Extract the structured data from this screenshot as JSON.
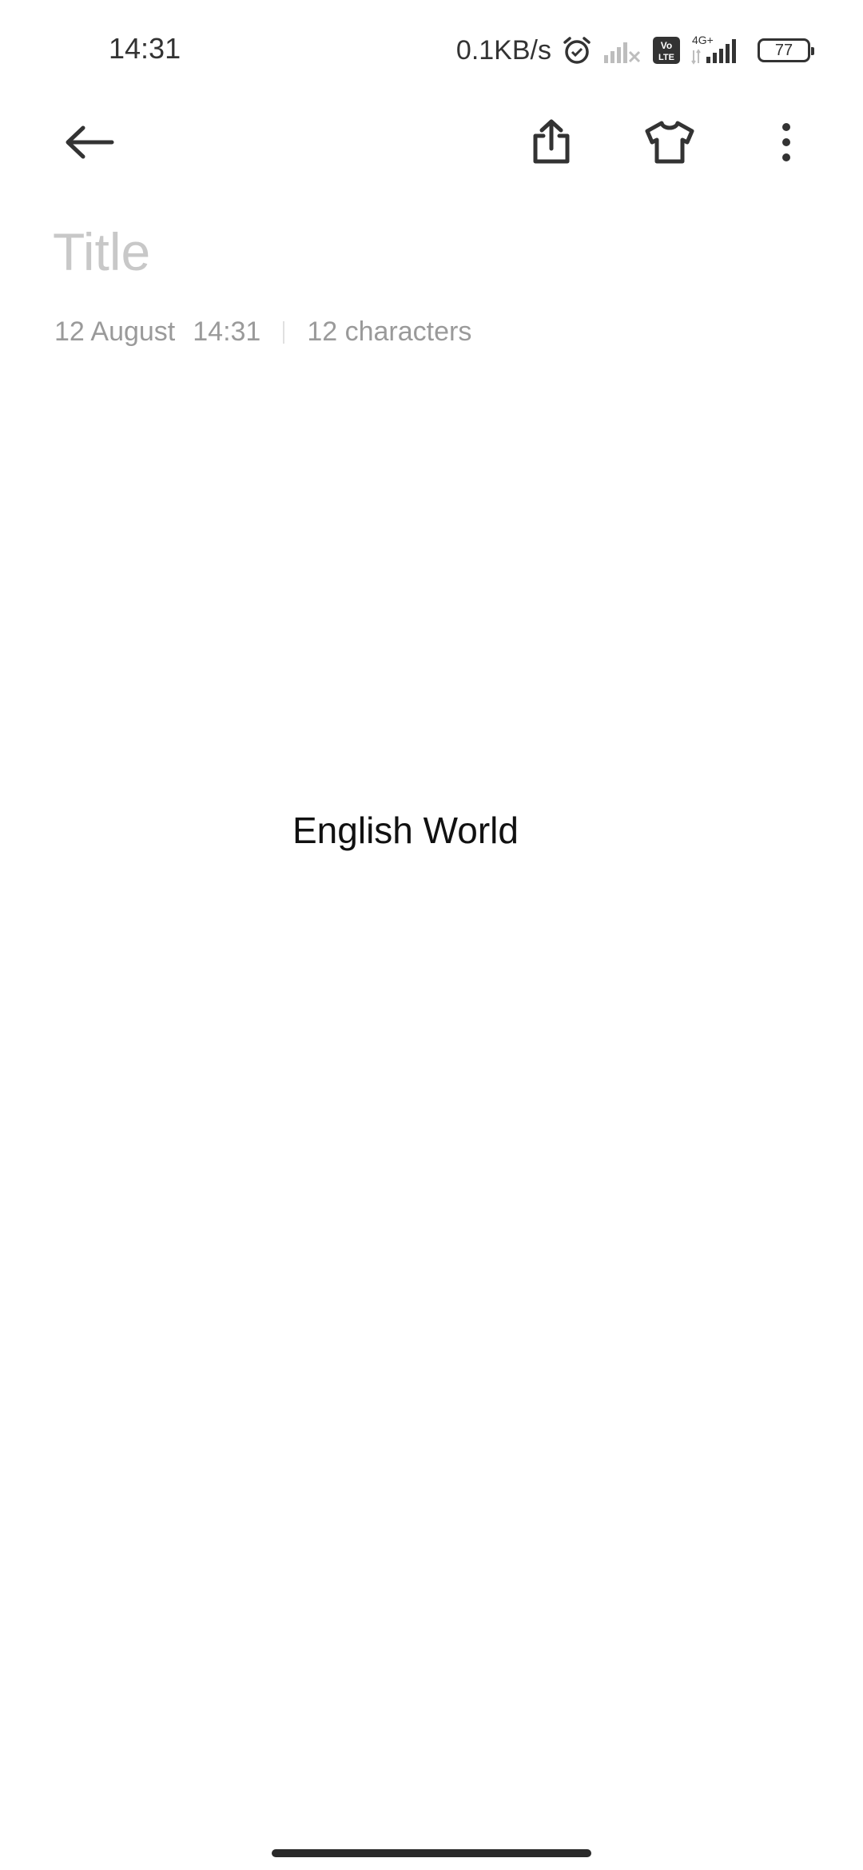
{
  "status_bar": {
    "time": "14:31",
    "net_speed": "0.1KB/s",
    "volte_label": "Vo LTE",
    "network_type": "4G+",
    "battery_level": "77",
    "icons": [
      "alarm-icon",
      "signal-off-icon",
      "volte-icon",
      "signal-icon",
      "battery-icon"
    ]
  },
  "toolbar": {
    "icons": [
      "back-arrow-icon",
      "share-icon",
      "theme-shirt-icon",
      "more-vertical-icon"
    ]
  },
  "note": {
    "title_placeholder": "Title",
    "title_value": "",
    "date": "12 August",
    "time": "14:31",
    "char_count": "12 characters",
    "body": "English World"
  },
  "colors": {
    "background": "#ffffff",
    "placeholder": "#c8c8c8",
    "meta_text": "#9a9a9a",
    "icon": "#333333"
  }
}
